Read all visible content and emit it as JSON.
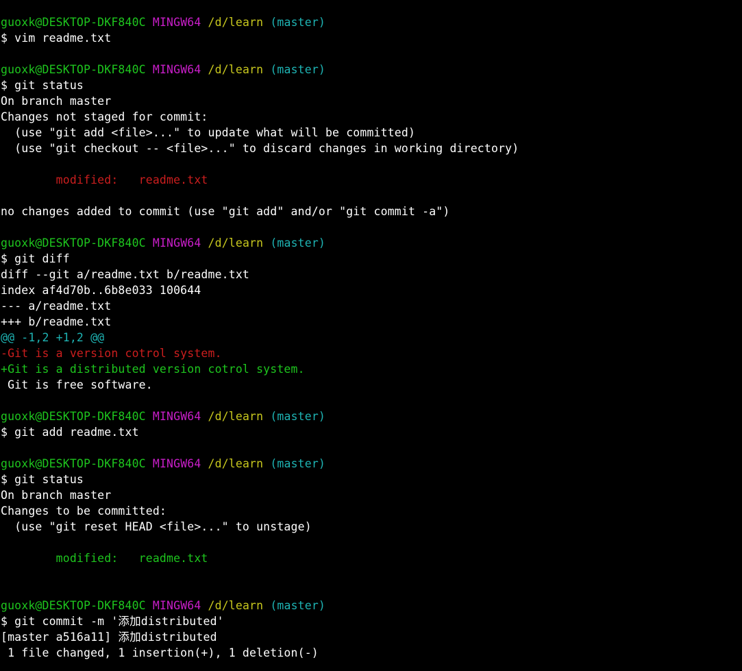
{
  "prompt": {
    "user_host": "guoxk@DESKTOP-DKF840C",
    "system": "MINGW64",
    "path": "/d/learn",
    "branch": "(master)"
  },
  "lines": [
    {
      "kind": "prompt"
    },
    {
      "kind": "text",
      "cls": "white",
      "text": "$ vim readme.txt"
    },
    {
      "kind": "text",
      "cls": "white",
      "text": ""
    },
    {
      "kind": "prompt"
    },
    {
      "kind": "text",
      "cls": "white",
      "text": "$ git status"
    },
    {
      "kind": "text",
      "cls": "white",
      "text": "On branch master"
    },
    {
      "kind": "text",
      "cls": "white",
      "text": "Changes not staged for commit:"
    },
    {
      "kind": "text",
      "cls": "white",
      "text": "  (use \"git add <file>...\" to update what will be committed)"
    },
    {
      "kind": "text",
      "cls": "white",
      "text": "  (use \"git checkout -- <file>...\" to discard changes in working directory)"
    },
    {
      "kind": "text",
      "cls": "white",
      "text": ""
    },
    {
      "kind": "text",
      "cls": "red",
      "text": "        modified:   readme.txt"
    },
    {
      "kind": "text",
      "cls": "white",
      "text": ""
    },
    {
      "kind": "text",
      "cls": "white",
      "text": "no changes added to commit (use \"git add\" and/or \"git commit -a\")"
    },
    {
      "kind": "text",
      "cls": "white",
      "text": ""
    },
    {
      "kind": "prompt"
    },
    {
      "kind": "text",
      "cls": "white",
      "text": "$ git diff"
    },
    {
      "kind": "text",
      "cls": "white",
      "text": "diff --git a/readme.txt b/readme.txt"
    },
    {
      "kind": "text",
      "cls": "white",
      "text": "index af4d70b..6b8e033 100644"
    },
    {
      "kind": "text",
      "cls": "white",
      "text": "--- a/readme.txt"
    },
    {
      "kind": "text",
      "cls": "white",
      "text": "+++ b/readme.txt"
    },
    {
      "kind": "text",
      "cls": "cyan",
      "text": "@@ -1,2 +1,2 @@"
    },
    {
      "kind": "text",
      "cls": "red",
      "text": "-Git is a version cotrol system."
    },
    {
      "kind": "text",
      "cls": "green",
      "text": "+Git is a distributed version cotrol system."
    },
    {
      "kind": "text",
      "cls": "white",
      "text": " Git is free software."
    },
    {
      "kind": "text",
      "cls": "white",
      "text": ""
    },
    {
      "kind": "prompt"
    },
    {
      "kind": "text",
      "cls": "white",
      "text": "$ git add readme.txt"
    },
    {
      "kind": "text",
      "cls": "white",
      "text": ""
    },
    {
      "kind": "prompt"
    },
    {
      "kind": "text",
      "cls": "white",
      "text": "$ git status"
    },
    {
      "kind": "text",
      "cls": "white",
      "text": "On branch master"
    },
    {
      "kind": "text",
      "cls": "white",
      "text": "Changes to be committed:"
    },
    {
      "kind": "text",
      "cls": "white",
      "text": "  (use \"git reset HEAD <file>...\" to unstage)"
    },
    {
      "kind": "text",
      "cls": "white",
      "text": ""
    },
    {
      "kind": "text",
      "cls": "green",
      "text": "        modified:   readme.txt"
    },
    {
      "kind": "text",
      "cls": "white",
      "text": ""
    },
    {
      "kind": "text",
      "cls": "white",
      "text": ""
    },
    {
      "kind": "prompt"
    },
    {
      "kind": "text",
      "cls": "white",
      "text": "$ git commit -m '添加distributed'"
    },
    {
      "kind": "text",
      "cls": "white",
      "text": "[master a516a11] 添加distributed"
    },
    {
      "kind": "text",
      "cls": "white",
      "text": " 1 file changed, 1 insertion(+), 1 deletion(-)"
    }
  ]
}
